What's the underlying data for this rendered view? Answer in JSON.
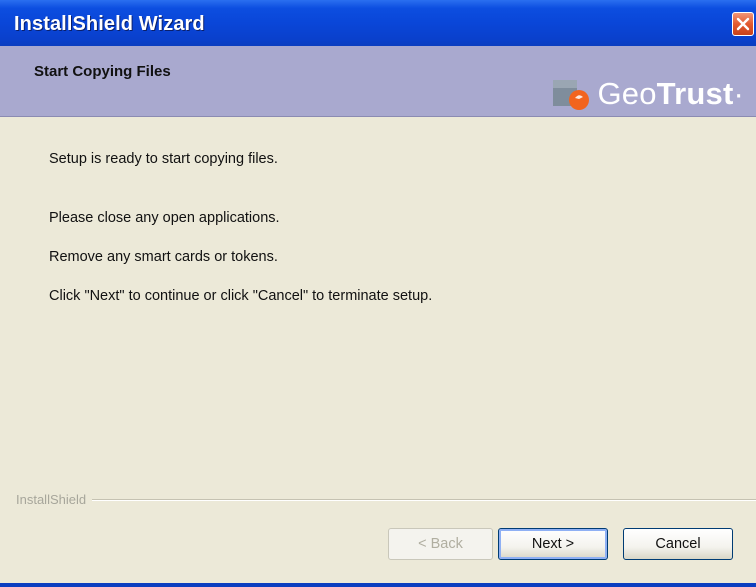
{
  "window": {
    "title": "InstallShield Wizard"
  },
  "header": {
    "title": "Start Copying Files",
    "logo": {
      "text_regular": "Geo",
      "text_bold": "Trust",
      "suffix": "·",
      "accent_color": "#f2641e"
    }
  },
  "content": {
    "lines": [
      "Setup is ready to start copying files.",
      "Please close any open applications.",
      "Remove any smart cards or tokens.",
      "Click \"Next\" to continue or click \"Cancel\" to terminate setup."
    ]
  },
  "footer": {
    "brand": "InstallShield",
    "buttons": {
      "back": "< Back",
      "next": "Next >",
      "cancel": "Cancel"
    }
  },
  "colors": {
    "titlebar": "#0a46d8",
    "header_bg": "#a9a9cf",
    "dialog_bg": "#ece9d8",
    "close": "#e25a30"
  },
  "icons": {
    "close": "close-icon",
    "logo": "geotrust-logo-icon"
  }
}
